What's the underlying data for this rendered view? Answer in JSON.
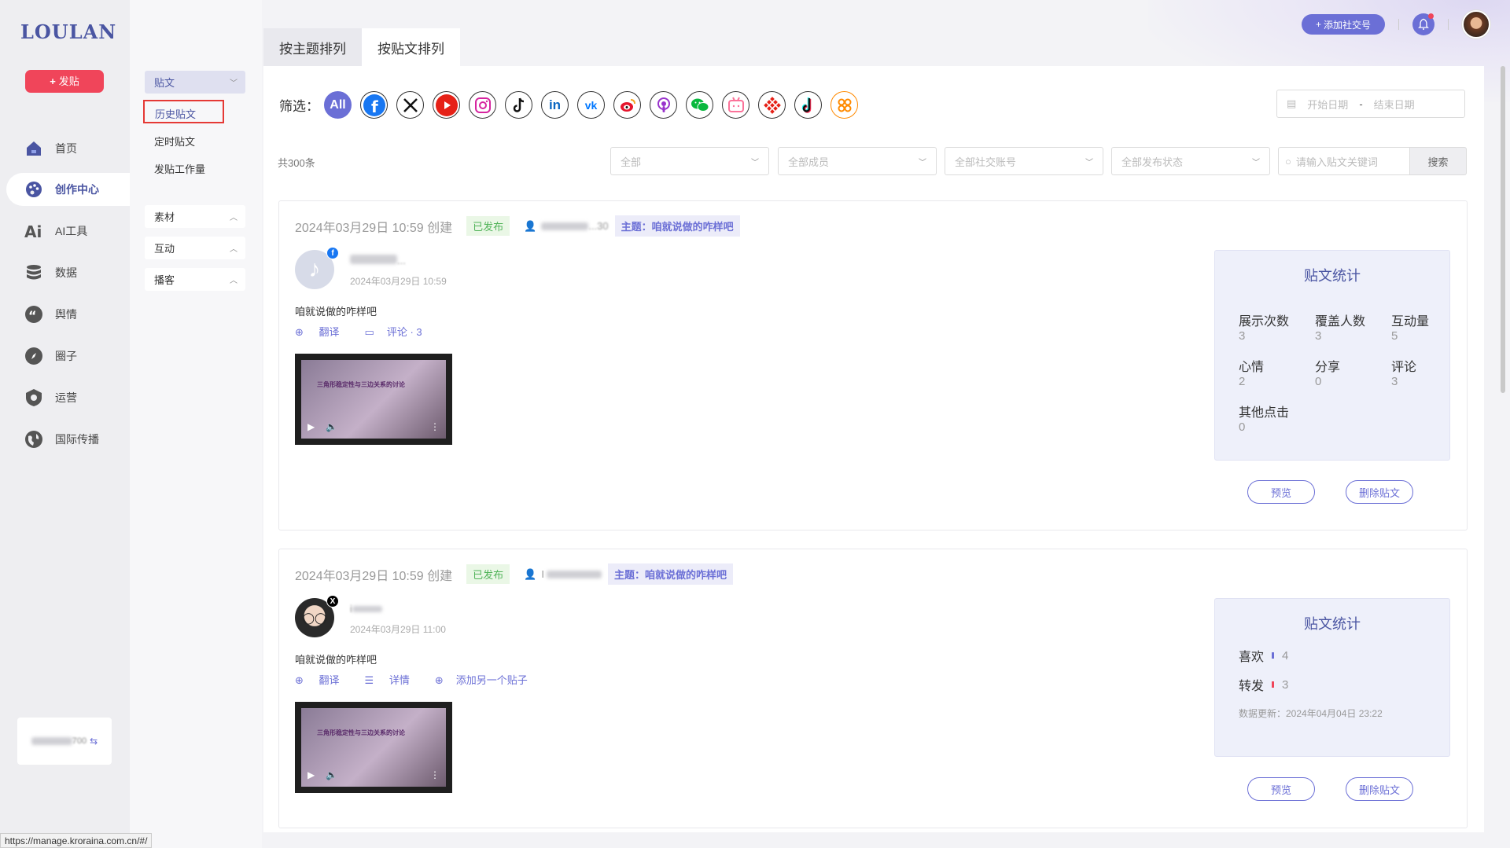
{
  "brand": {
    "logo": "LOULAN",
    "post_button": "发贴"
  },
  "nav": {
    "items": [
      {
        "label": "首页",
        "icon": "home-icon"
      },
      {
        "label": "创作中心",
        "icon": "palette-icon",
        "active": true
      },
      {
        "label": "AI工具",
        "icon": "ai-icon"
      },
      {
        "label": "数据",
        "icon": "database-icon"
      },
      {
        "label": "舆情",
        "icon": "quote-icon"
      },
      {
        "label": "圈子",
        "icon": "compass-icon"
      },
      {
        "label": "运营",
        "icon": "shield-icon"
      },
      {
        "label": "国际传播",
        "icon": "globe-icon"
      }
    ]
  },
  "user_card": {
    "name_suffix": "700"
  },
  "subnav": {
    "group_posts": "贴文",
    "items": [
      "历史贴文",
      "定时贴文",
      "发贴工作量"
    ],
    "group_material": "素材",
    "group_interact": "互动",
    "group_podcast": "播客"
  },
  "tabs": [
    "按主题排列",
    "按贴文排列"
  ],
  "filter": {
    "label": "筛选：",
    "all": "All",
    "platforms": [
      "facebook",
      "x",
      "youtube",
      "instagram",
      "tiktok",
      "linkedin",
      "vk",
      "weibo",
      "podcast",
      "wechat",
      "bilibili",
      "kuaishou",
      "douyin",
      "xiaohongshu"
    ],
    "date_start": "开始日期",
    "date_sep": "-",
    "date_end": "结束日期"
  },
  "list": {
    "total": "共300条",
    "selects": [
      "全部",
      "全部成员",
      "全部社交账号",
      "全部发布状态"
    ],
    "search_placeholder": "请输入贴文关键词",
    "search_button": "搜索"
  },
  "posts": [
    {
      "created": "2024年03月29日 10:59 创建",
      "status": "已发布",
      "user": "...30",
      "topic": "主题：咱就说做的咋样吧",
      "platform_badge": "f",
      "author": "...",
      "time": "2024年03月29日 10:59",
      "text": "咱就说做的咋样吧",
      "actions": [
        "翻译",
        "评论 · 3"
      ],
      "video_caption": "三角形稳定性与三边关系的讨论",
      "stats_title": "贴文统计",
      "stats": [
        {
          "k": "展示次数",
          "v": "3"
        },
        {
          "k": "覆盖人数",
          "v": "3"
        },
        {
          "k": "互动量",
          "v": "5"
        },
        {
          "k": "心情",
          "v": "2"
        },
        {
          "k": "分享",
          "v": "0"
        },
        {
          "k": "评论",
          "v": "3"
        },
        {
          "k": "其他点击",
          "v": "0"
        }
      ],
      "btn_preview": "预览",
      "btn_delete": "删除贴文"
    },
    {
      "created": "2024年03月29日 10:59 创建",
      "status": "已发布",
      "user": "I",
      "topic": "主题：咱就说做的咋样吧",
      "platform_badge": "X",
      "author": "i",
      "time": "2024年03月29日 11:00",
      "text": "咱就说做的咋样吧",
      "actions": [
        "翻译",
        "详情",
        "添加另一个贴子"
      ],
      "video_caption": "三角形稳定性与三边关系的讨论",
      "stats_title": "贴文统计",
      "likes_label": "喜欢",
      "likes": "4",
      "reposts_label": "转发",
      "reposts": "3",
      "updated": "数据更新：2024年04月04日 23:22",
      "btn_preview": "预览",
      "btn_delete": "删除贴文"
    }
  ],
  "topbar": {
    "add_social": "添加社交号"
  },
  "status_url": "https://manage.kroraina.com.cn/#/",
  "colors": {
    "accent": "#6b6fd6",
    "brand": "#4a55a2",
    "danger": "#f0455a",
    "success": "#52b45a"
  }
}
